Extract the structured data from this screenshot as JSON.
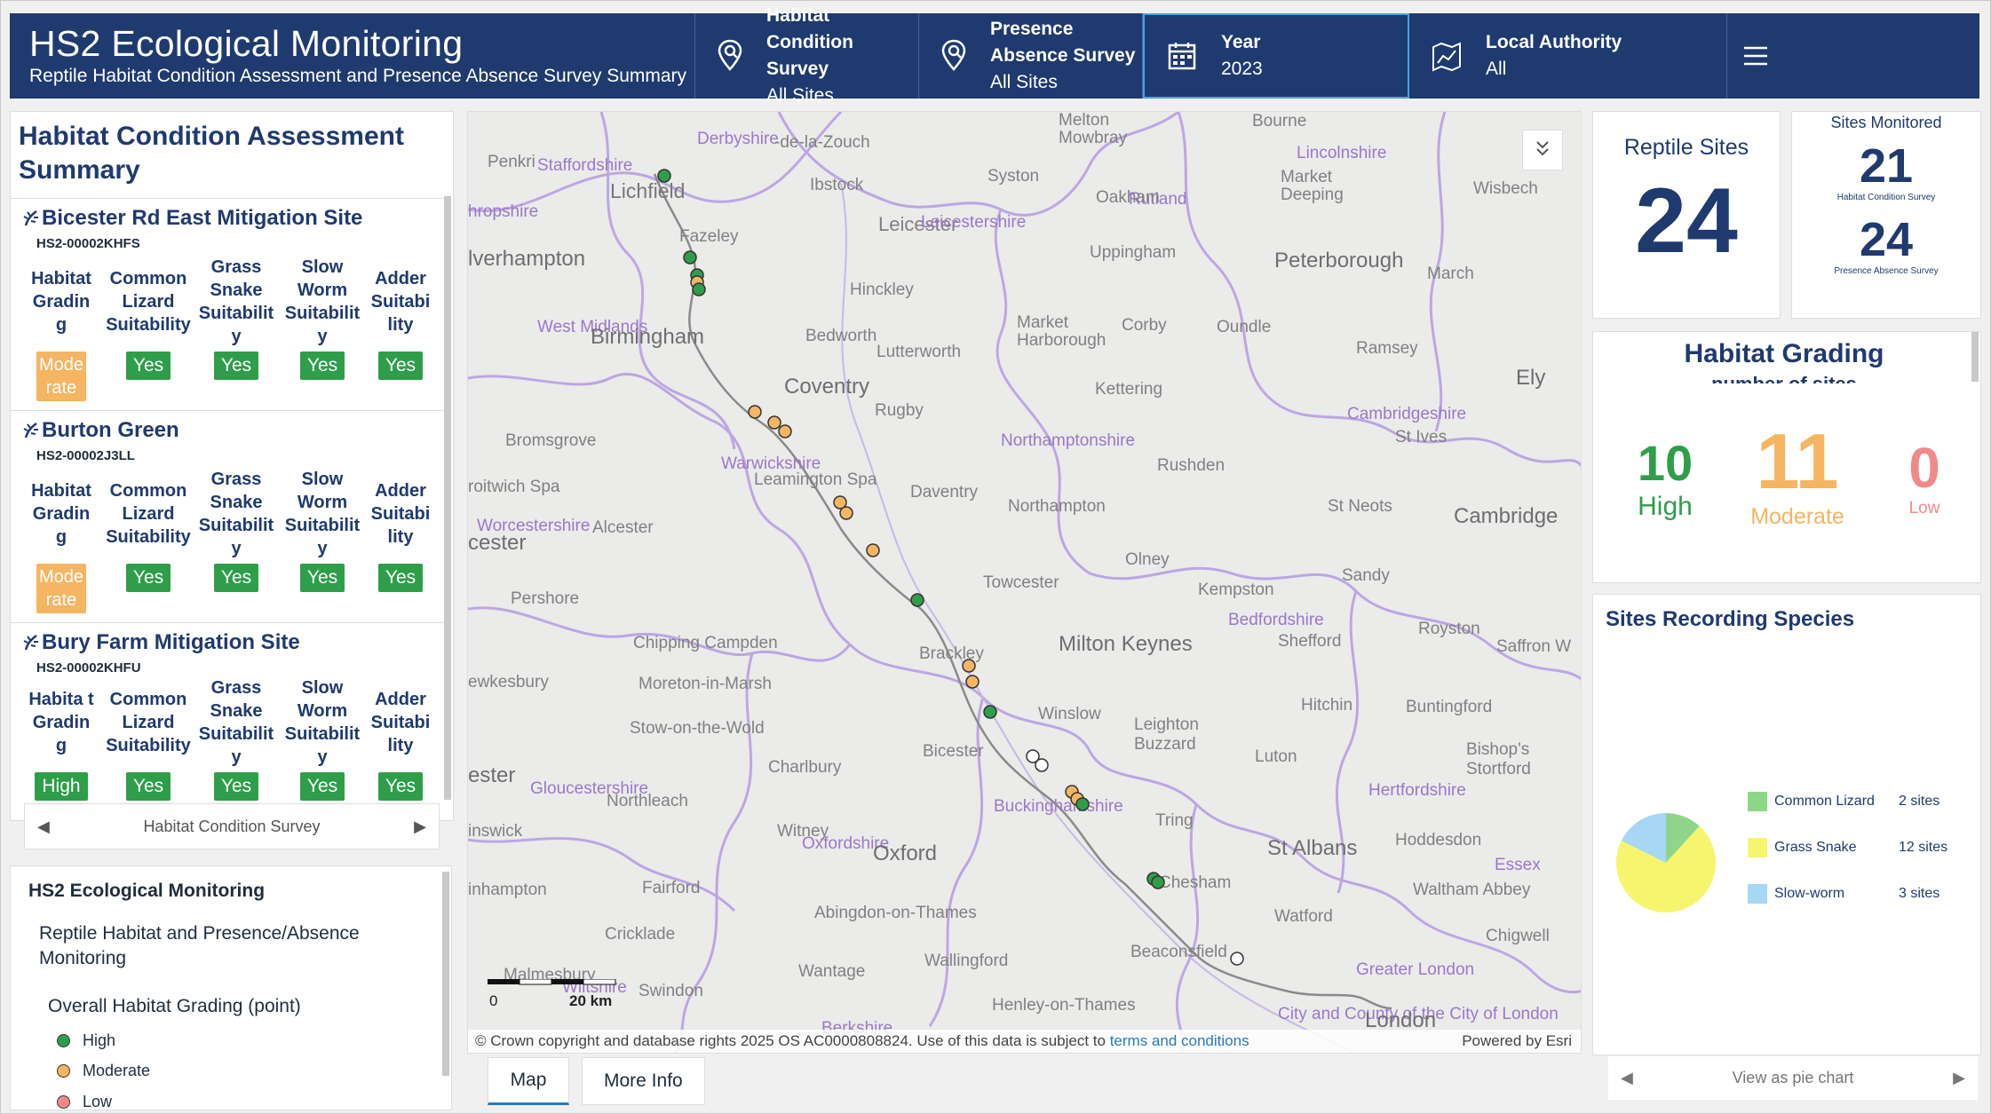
{
  "header": {
    "title": "HS2 Ecological Monitoring",
    "subtitle": "Reptile Habitat Condition Assessment and Presence Absence Survey Summary",
    "selectors": [
      {
        "label": "Habitat Condition Survey",
        "value": "All Sites",
        "icon": "map-pin-search-icon"
      },
      {
        "label": "Presence Absence Survey",
        "value": "All Sites",
        "icon": "map-pin-search-icon"
      },
      {
        "label": "Year",
        "value": "2023",
        "icon": "calendar-icon"
      },
      {
        "label": "Local Authority",
        "value": "All",
        "icon": "map-icon"
      }
    ],
    "menu_icon": "hamburger-menu-icon"
  },
  "hca": {
    "title": "Habitat Condition Assessment Summary",
    "columns": [
      "Habitat Gradin g",
      "Common Lizard Suitability",
      "Grass Snake Suitabilit y",
      "Slow Worm Suitabilit y",
      "Adder Suitabi lity"
    ],
    "sites": [
      {
        "name": "Bicester Rd East Mitigation Site",
        "code": "HS2-00002KHFS",
        "grading": "Mode rate",
        "common_lizard": "Yes",
        "grass_snake": "Yes",
        "slow_worm": "Yes",
        "adder": "Yes"
      },
      {
        "name": "Burton Green",
        "code": "HS2-00002J3LL",
        "grading": "Mode rate",
        "common_lizard": "Yes",
        "grass_snake": "Yes",
        "slow_worm": "Yes",
        "adder": "Yes"
      },
      {
        "name": "Bury Farm Mitigation Site",
        "code": "HS2-00002KHFU",
        "grading_header": "Habita t Gradin g",
        "grading": "High",
        "common_lizard": "Yes",
        "grass_snake": "Yes",
        "slow_worm": "Yes",
        "adder": "Yes"
      }
    ],
    "pager_label": "Habitat Condition Survey"
  },
  "legend": {
    "title": "HS2 Ecological Monitoring",
    "layer": "Reptile Habitat and Presence/Absence Monitoring",
    "heading": "Overall Habitat Grading (point)",
    "items": [
      {
        "label": "High",
        "color": "#2e9e4a"
      },
      {
        "label": "Moderate",
        "color": "#f5b562"
      },
      {
        "label": "Low",
        "color": "#f08a8a"
      }
    ]
  },
  "map": {
    "labels": {
      "derbyshire": "Derbyshire",
      "ashby": "-de-la-Zouch",
      "melton": "Melton Mowbray",
      "bourne": "Bourne",
      "lincolnshire": "Lincolnshire",
      "penkridge": "Penkri",
      "staffordshire": "Staffordshire",
      "lichfield": "Lichfield",
      "ibstock": "Ibstock",
      "syston": "Syston",
      "market_deeping": "Market Deeping",
      "wisbech": "Wisbech",
      "shropshire": "hropshire",
      "leicester": "Leicester",
      "leicestershire": "Leicestershire",
      "rutland": "Rutland",
      "oakham": "Oakham",
      "wolverhampton": "lverhampton",
      "fazeley": "Fazeley",
      "uppingham": "Uppingham",
      "peterborough": "Peterborough",
      "march": "March",
      "hinckley": "Hinckley",
      "west_midlands": "West Midlands",
      "birmingham": "Birmingham",
      "bedworth": "Bedworth",
      "market_harborough": "Market Harborough",
      "corby": "Corby",
      "oundle": "Oundle",
      "lutterworth": "Lutterworth",
      "ramsey": "Ramsey",
      "coventry": "Coventry",
      "ely": "Ely",
      "rugby": "Rugby",
      "kettering": "Kettering",
      "cambridgeshire": "Cambridgeshire",
      "st_ives": "St Ives",
      "bromsgrove": "Bromsgrove",
      "warwickshire": "Warwickshire",
      "leamington": "Leamington Spa",
      "northamptonshire": "Northamptonshire",
      "droitwich": "roitwich Spa",
      "daventry": "Daventry",
      "rushden": "Rushden",
      "worcestershire": "Worcestershire",
      "worcester": "cester",
      "alcester": "Alcester",
      "northampton": "Northampton",
      "st_neots": "St Neots",
      "cambridge": "Cambridge",
      "olney": "Olney",
      "sandy": "Sandy",
      "pershore": "Pershore",
      "towcester": "Towcester",
      "kempston": "Kempston",
      "bedfordshire": "Bedfordshire",
      "shefford": "Shefford",
      "royston": "Royston",
      "saffron": "Saffron W",
      "chipping_campden": "Chipping Campden",
      "brackley": "Brackley",
      "milton_keynes": "Milton Keynes",
      "tewkesbury": "ewkesbury",
      "moreton": "Moreton-in-Marsh",
      "stow": "Stow-on-the-Wold",
      "winslow": "Winslow",
      "hitchin": "Hitchin",
      "buntingford": "Buntingford",
      "leighton_buzzard": "Leighton Buzzard",
      "bishops_stortford": "Bishop's Stortford",
      "cheltenham": "ester",
      "charlbury": "Charlbury",
      "bicester": "Bicester",
      "luton": "Luton",
      "gloucestershire": "Gloucestershire",
      "northleach": "Northleach",
      "hertfordshire": "Hertfordshire",
      "buckinghamshire": "Buckinghamshire",
      "tring": "Tring",
      "minchinhampton": "inswick",
      "witney": "Witney",
      "oxfordshire": "Oxfordshire",
      "oxford": "Oxford",
      "st_albans": "St Albans",
      "hoddesdon": "Hoddesdon",
      "essex": "Essex",
      "fairford": "Fairford",
      "chesham": "Chesham",
      "waltham_abbey": "Waltham Abbey",
      "tetbury": "inhampton",
      "abingdon": "Abingdon-on-Thames",
      "watford": "Watford",
      "cricklade": "Cricklade",
      "beaconsfield": "Beaconsfield",
      "chigwell": "Chigwell",
      "wantage": "Wantage",
      "wallingford": "Wallingford",
      "greater_london": "Greater London",
      "malmesbury": "Malmesbury",
      "wiltshire": "Wiltshire",
      "swindon": "Swindon",
      "henley": "Henley-on-Thames",
      "city": "City and County of the City of London",
      "london": "London",
      "berkshire": "Berkshire"
    },
    "scale_0": "0",
    "scale_20": "20 km",
    "attribution": "© Crown copyright and database rights 2025 OS AC0000808824. Use of this data is subject to",
    "terms_link": "terms and conditions",
    "powered": "Powered by Esri"
  },
  "tabs": [
    "Map",
    "More Info"
  ],
  "stats": {
    "reptile_sites_label": "Reptile Sites",
    "reptile_sites_value": "24",
    "sites_monitored_label": "Sites Monitored",
    "hcs_value": "21",
    "hcs_label": "Habitat Condition Survey",
    "pas_value": "24",
    "pas_label": "Presence Absence Survey"
  },
  "grading": {
    "title": "Habitat Grading",
    "subtitle": "number of sites",
    "high_value": "10",
    "high_label": "High",
    "high_color": "#2e9e4a",
    "moderate_value": "11",
    "moderate_label": "Moderate",
    "moderate_color": "#f5b562",
    "low_value": "0",
    "low_label": "Low",
    "low_color": "#f08a8a"
  },
  "species": {
    "title": "Sites Recording Species",
    "items": [
      {
        "label": "Common Lizard",
        "count": "2 sites",
        "value": 2,
        "color": "#8fd68a"
      },
      {
        "label": "Grass Snake",
        "count": "12 sites",
        "value": 12,
        "color": "#f7f56e"
      },
      {
        "label": "Slow-worm",
        "count": "3 sites",
        "value": 3,
        "color": "#a8d6f5"
      }
    ],
    "pager_label": "View as pie chart"
  }
}
